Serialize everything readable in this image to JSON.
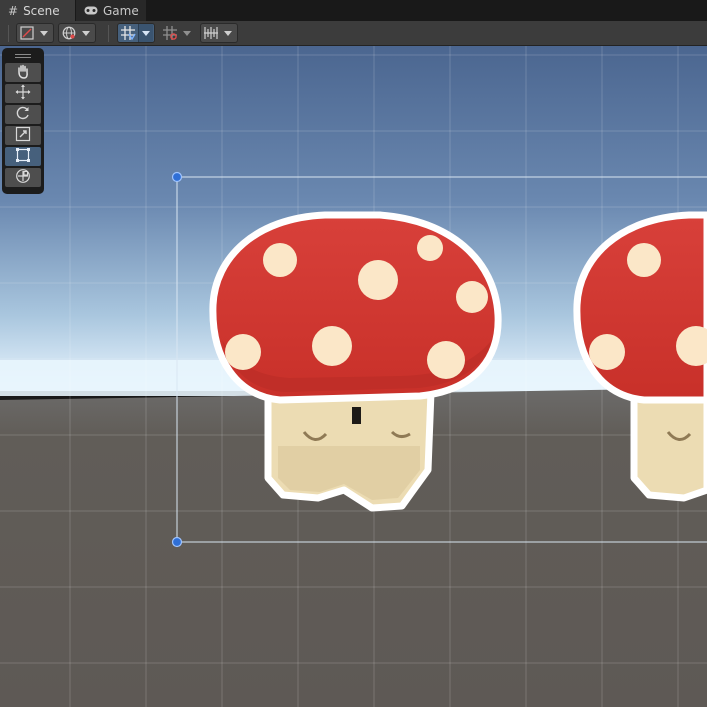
{
  "tabs": [
    {
      "label": "Scene",
      "icon": "grid-hash-icon",
      "active": true
    },
    {
      "label": "Game",
      "icon": "gamepad-icon",
      "active": false
    }
  ],
  "toolbar": {
    "items": [
      {
        "name": "draw-mode-dropdown",
        "icon": "draw-mode-icon",
        "has_dropdown": true,
        "active": false
      },
      {
        "name": "scene-effects-dropdown",
        "icon": "globe-icon",
        "has_dropdown": true,
        "active": false
      },
      {
        "name": "grid-snapping-toggle",
        "icon": "grid-snap-icon",
        "has_dropdown": true,
        "active": true
      },
      {
        "name": "increment-snap-toggle",
        "icon": "increment-snap-icon",
        "has_dropdown": true,
        "active": false
      },
      {
        "name": "snap-settings-dropdown",
        "icon": "snap-settings-icon",
        "has_dropdown": true,
        "active": false
      }
    ]
  },
  "tools": [
    {
      "name": "hand-tool",
      "icon": "hand-icon",
      "active": false
    },
    {
      "name": "move-tool",
      "icon": "move-arrows-icon",
      "active": false
    },
    {
      "name": "rotate-tool",
      "icon": "rotate-icon",
      "active": false
    },
    {
      "name": "scale-tool",
      "icon": "scale-icon",
      "active": false
    },
    {
      "name": "rect-tool",
      "icon": "rect-transform-icon",
      "active": true
    },
    {
      "name": "transform-tool",
      "icon": "transform-icon",
      "active": false
    }
  ],
  "scene": {
    "objects": [
      {
        "name": "mushroom-sprite",
        "selected": true
      },
      {
        "name": "mushroom-sprite",
        "selected": false
      }
    ],
    "colors": {
      "sky_top": "#4f6b94",
      "horizon": "#eaf6ff",
      "ground": "#5f5a55",
      "cap_red": "#d43832",
      "spot_cream": "#fbe7c8",
      "stem": "#ecdcb3",
      "outline": "#ffffff",
      "handle_blue": "#2f6fd6"
    }
  }
}
